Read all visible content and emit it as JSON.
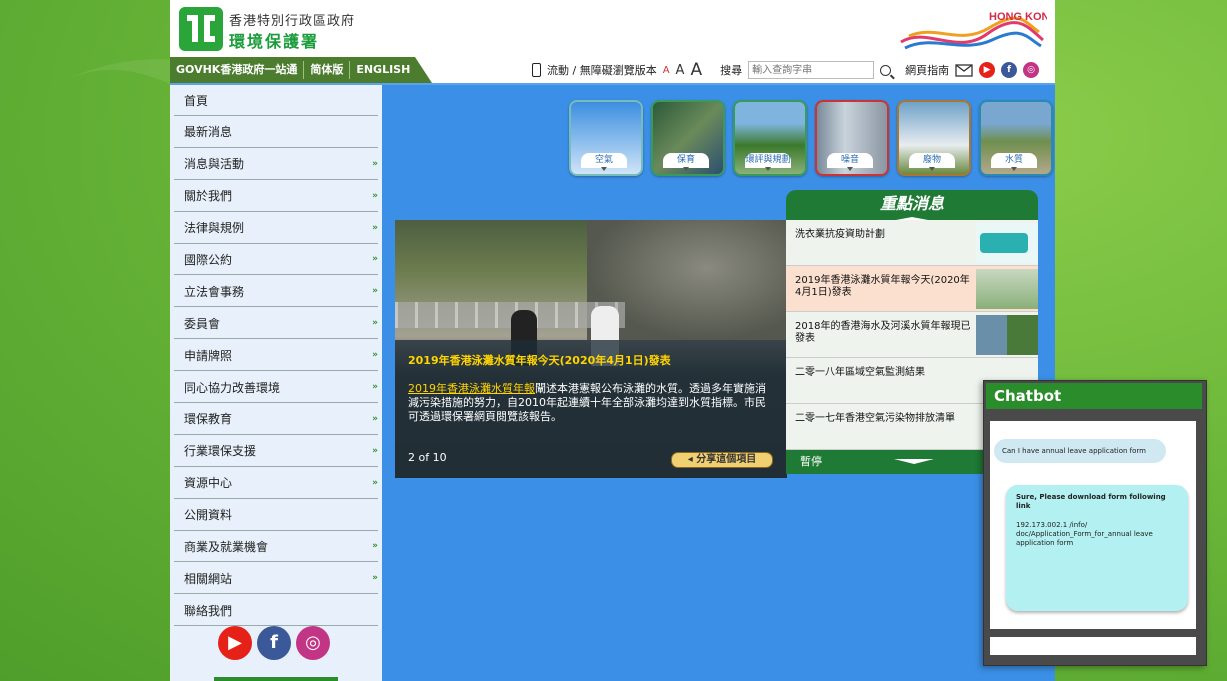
{
  "header": {
    "org_name_top": "香港特別行政區政府",
    "org_name_bottom": "環境保護署",
    "brand": "HONG KONG 香港"
  },
  "gov_nav": {
    "items": [
      "GOVHK香港政府一站通",
      "简体版",
      "ENGLISH"
    ]
  },
  "tools": {
    "mobile_label": "流動 / 無障礙瀏覽版本",
    "font_small": "A",
    "font_medium": "A",
    "font_large": "A",
    "search_label": "搜尋",
    "search_placeholder": "輸入查詢字串",
    "site_guide": "網頁指南"
  },
  "sidebar": {
    "items": [
      {
        "label": "首頁",
        "arrow": ""
      },
      {
        "label": "最新消息",
        "arrow": ""
      },
      {
        "label": "消息與活動",
        "arrow": "»"
      },
      {
        "label": "關於我們",
        "arrow": "»"
      },
      {
        "label": "法律與規例",
        "arrow": "»"
      },
      {
        "label": "國際公約",
        "arrow": "»"
      },
      {
        "label": "立法會事務",
        "arrow": "»"
      },
      {
        "label": "委員會",
        "arrow": "»"
      },
      {
        "label": "申請牌照",
        "arrow": "»"
      },
      {
        "label": "同心協力改善環境",
        "arrow": "»"
      },
      {
        "label": "環保教育",
        "arrow": "»"
      },
      {
        "label": "行業環保支援",
        "arrow": "»"
      },
      {
        "label": "資源中心",
        "arrow": "»"
      },
      {
        "label": "公開資料",
        "arrow": ""
      },
      {
        "label": "商業及就業機會",
        "arrow": "»"
      },
      {
        "label": "相關網站",
        "arrow": "»"
      },
      {
        "label": "聯絡我們",
        "arrow": ""
      }
    ]
  },
  "topics": [
    "空氣",
    "保育",
    "環評與規劃",
    "噪音",
    "廢物",
    "水質"
  ],
  "carousel": {
    "title": "2019年香港泳灘水質年報今天(2020年4月1日)發表",
    "link_text": "2019年香港泳灘水質年報",
    "body": "闡述本港憲報公布泳灘的水質。透過多年實施消減污染措施的努力，自2010年起連續十年全部泳灘均達到水質指標。市民可透過環保署網頁閱覽該報告。",
    "counter": "2 of 10",
    "share": "分享這個項目"
  },
  "news": {
    "heading": "重點消息",
    "items": [
      "洗衣業抗疫資助計劃",
      "2019年香港泳灘水質年報今天(2020年4月1日)發表",
      "2018年的香港海水及河溪水質年報現已發表",
      "二零一八年區域空氣監測結果",
      "二零一七年香港空氣污染物排放清單"
    ],
    "pause": "暫停"
  },
  "chatbot": {
    "title": "Chatbot",
    "user_msg": "Can I have annual leave application form",
    "bot_msg_line1": "Sure, Please download form following link",
    "bot_msg_line2": "192.173.002.1 /info/ doc/Application_Form_for_annual leave application form"
  }
}
